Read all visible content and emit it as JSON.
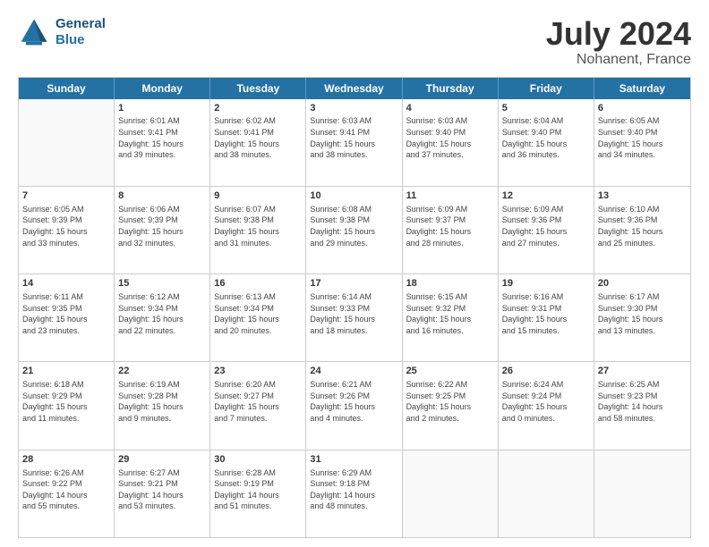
{
  "header": {
    "logo_line1": "General",
    "logo_line2": "Blue",
    "title": "July 2024",
    "subtitle": "Nohanent, France"
  },
  "calendar": {
    "days": [
      "Sunday",
      "Monday",
      "Tuesday",
      "Wednesday",
      "Thursday",
      "Friday",
      "Saturday"
    ],
    "rows": [
      [
        {
          "day": "",
          "info": ""
        },
        {
          "day": "1",
          "info": "Sunrise: 6:01 AM\nSunset: 9:41 PM\nDaylight: 15 hours\nand 39 minutes."
        },
        {
          "day": "2",
          "info": "Sunrise: 6:02 AM\nSunset: 9:41 PM\nDaylight: 15 hours\nand 38 minutes."
        },
        {
          "day": "3",
          "info": "Sunrise: 6:03 AM\nSunset: 9:41 PM\nDaylight: 15 hours\nand 38 minutes."
        },
        {
          "day": "4",
          "info": "Sunrise: 6:03 AM\nSunset: 9:40 PM\nDaylight: 15 hours\nand 37 minutes."
        },
        {
          "day": "5",
          "info": "Sunrise: 6:04 AM\nSunset: 9:40 PM\nDaylight: 15 hours\nand 36 minutes."
        },
        {
          "day": "6",
          "info": "Sunrise: 6:05 AM\nSunset: 9:40 PM\nDaylight: 15 hours\nand 34 minutes."
        }
      ],
      [
        {
          "day": "7",
          "info": "Sunrise: 6:05 AM\nSunset: 9:39 PM\nDaylight: 15 hours\nand 33 minutes."
        },
        {
          "day": "8",
          "info": "Sunrise: 6:06 AM\nSunset: 9:39 PM\nDaylight: 15 hours\nand 32 minutes."
        },
        {
          "day": "9",
          "info": "Sunrise: 6:07 AM\nSunset: 9:38 PM\nDaylight: 15 hours\nand 31 minutes."
        },
        {
          "day": "10",
          "info": "Sunrise: 6:08 AM\nSunset: 9:38 PM\nDaylight: 15 hours\nand 29 minutes."
        },
        {
          "day": "11",
          "info": "Sunrise: 6:09 AM\nSunset: 9:37 PM\nDaylight: 15 hours\nand 28 minutes."
        },
        {
          "day": "12",
          "info": "Sunrise: 6:09 AM\nSunset: 9:36 PM\nDaylight: 15 hours\nand 27 minutes."
        },
        {
          "day": "13",
          "info": "Sunrise: 6:10 AM\nSunset: 9:36 PM\nDaylight: 15 hours\nand 25 minutes."
        }
      ],
      [
        {
          "day": "14",
          "info": "Sunrise: 6:11 AM\nSunset: 9:35 PM\nDaylight: 15 hours\nand 23 minutes."
        },
        {
          "day": "15",
          "info": "Sunrise: 6:12 AM\nSunset: 9:34 PM\nDaylight: 15 hours\nand 22 minutes."
        },
        {
          "day": "16",
          "info": "Sunrise: 6:13 AM\nSunset: 9:34 PM\nDaylight: 15 hours\nand 20 minutes."
        },
        {
          "day": "17",
          "info": "Sunrise: 6:14 AM\nSunset: 9:33 PM\nDaylight: 15 hours\nand 18 minutes."
        },
        {
          "day": "18",
          "info": "Sunrise: 6:15 AM\nSunset: 9:32 PM\nDaylight: 15 hours\nand 16 minutes."
        },
        {
          "day": "19",
          "info": "Sunrise: 6:16 AM\nSunset: 9:31 PM\nDaylight: 15 hours\nand 15 minutes."
        },
        {
          "day": "20",
          "info": "Sunrise: 6:17 AM\nSunset: 9:30 PM\nDaylight: 15 hours\nand 13 minutes."
        }
      ],
      [
        {
          "day": "21",
          "info": "Sunrise: 6:18 AM\nSunset: 9:29 PM\nDaylight: 15 hours\nand 11 minutes."
        },
        {
          "day": "22",
          "info": "Sunrise: 6:19 AM\nSunset: 9:28 PM\nDaylight: 15 hours\nand 9 minutes."
        },
        {
          "day": "23",
          "info": "Sunrise: 6:20 AM\nSunset: 9:27 PM\nDaylight: 15 hours\nand 7 minutes."
        },
        {
          "day": "24",
          "info": "Sunrise: 6:21 AM\nSunset: 9:26 PM\nDaylight: 15 hours\nand 4 minutes."
        },
        {
          "day": "25",
          "info": "Sunrise: 6:22 AM\nSunset: 9:25 PM\nDaylight: 15 hours\nand 2 minutes."
        },
        {
          "day": "26",
          "info": "Sunrise: 6:24 AM\nSunset: 9:24 PM\nDaylight: 15 hours\nand 0 minutes."
        },
        {
          "day": "27",
          "info": "Sunrise: 6:25 AM\nSunset: 9:23 PM\nDaylight: 14 hours\nand 58 minutes."
        }
      ],
      [
        {
          "day": "28",
          "info": "Sunrise: 6:26 AM\nSunset: 9:22 PM\nDaylight: 14 hours\nand 55 minutes."
        },
        {
          "day": "29",
          "info": "Sunrise: 6:27 AM\nSunset: 9:21 PM\nDaylight: 14 hours\nand 53 minutes."
        },
        {
          "day": "30",
          "info": "Sunrise: 6:28 AM\nSunset: 9:19 PM\nDaylight: 14 hours\nand 51 minutes."
        },
        {
          "day": "31",
          "info": "Sunrise: 6:29 AM\nSunset: 9:18 PM\nDaylight: 14 hours\nand 48 minutes."
        },
        {
          "day": "",
          "info": ""
        },
        {
          "day": "",
          "info": ""
        },
        {
          "day": "",
          "info": ""
        }
      ]
    ]
  }
}
